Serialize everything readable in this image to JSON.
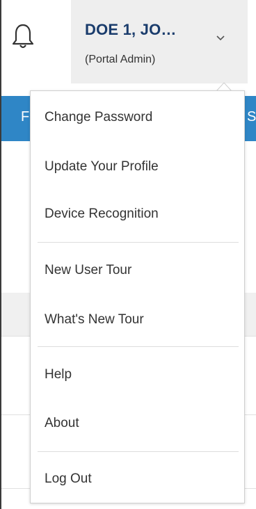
{
  "header": {
    "user_name": "DOE 1, JO…",
    "user_role": "(Portal Admin)",
    "notification_icon": "bell-icon",
    "caret_icon": "chevron-down-icon"
  },
  "background": {
    "nav_left_letter": "F",
    "nav_right_letter": "S",
    "nav_color": "#2f86c6"
  },
  "menu": {
    "items": [
      {
        "label": "Change Password"
      },
      {
        "label": "Update Your Profile"
      },
      {
        "label": "Device Recognition"
      },
      {
        "label": "New User Tour"
      },
      {
        "label": "What's New Tour"
      },
      {
        "label": "Help"
      },
      {
        "label": "About"
      },
      {
        "label": "Log Out"
      }
    ]
  }
}
